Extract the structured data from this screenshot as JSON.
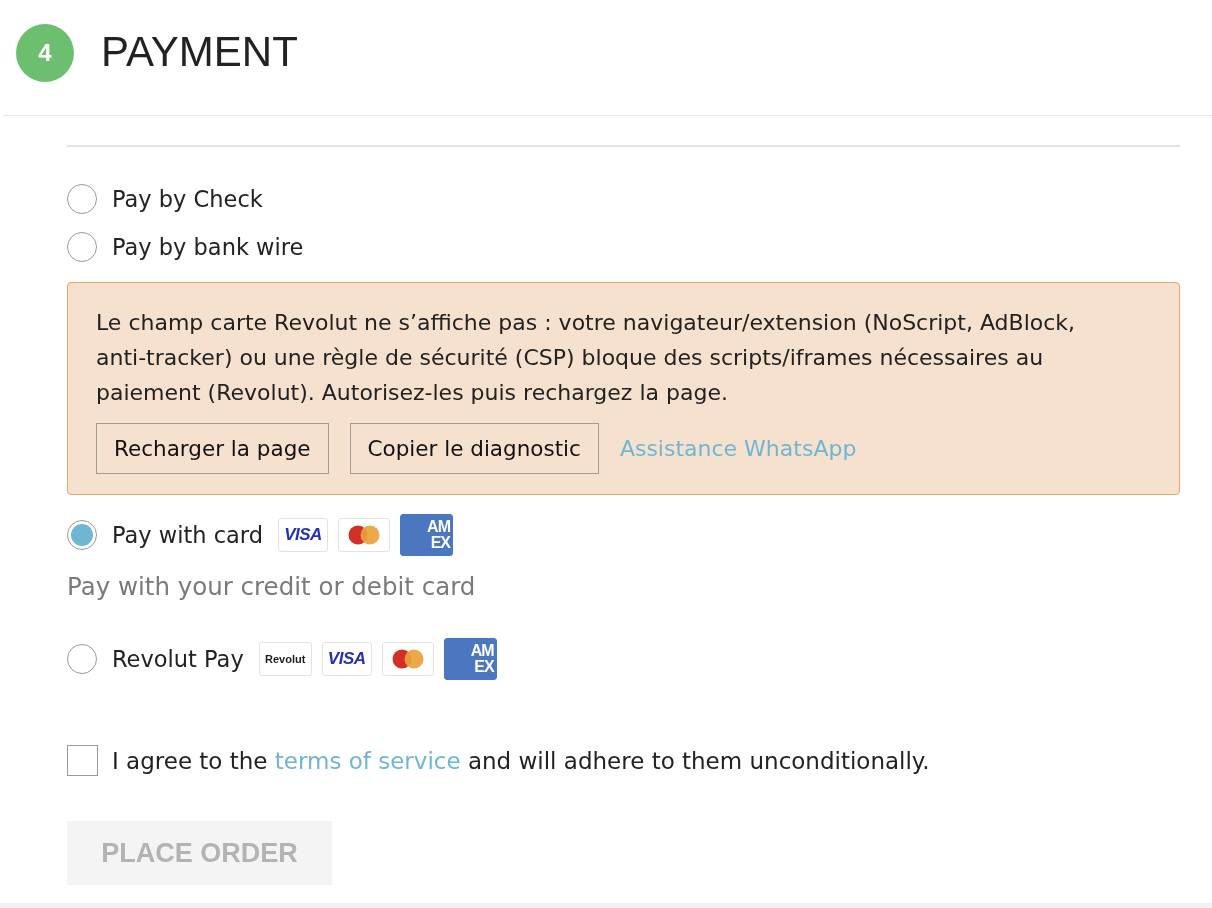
{
  "step": {
    "number": "4",
    "title": "PAYMENT"
  },
  "payment_options": [
    {
      "label": "Pay by Check",
      "selected": false
    },
    {
      "label": "Pay by bank wire",
      "selected": false
    },
    {
      "notice": {
        "message": "Le champ carte Revolut ne s’affiche pas : votre navigateur/extension (NoScript, AdBlock, anti-tracker) ou une règle de sécurité (CSP) bloque des scripts/iframes nécessaires au paiement (Revolut). Autorisez-les puis rechargez la page.",
        "buttons": [
          "Recharger la page",
          "Copier le diagnostic"
        ],
        "link": "Assistance WhatsApp"
      },
      "label": "Pay with card",
      "selected": true,
      "logos": [
        {
          "kind": "visa",
          "text": "VISA"
        },
        {
          "kind": "mastercard"
        },
        {
          "kind": "amex",
          "lines": [
            "AM",
            "EX"
          ]
        }
      ],
      "description": "Pay with your credit or debit card"
    },
    {
      "label": "Revolut Pay",
      "selected": false,
      "logos": [
        {
          "kind": "revolut",
          "text": "Revolut"
        },
        {
          "kind": "visa",
          "text": "VISA"
        },
        {
          "kind": "mastercard"
        },
        {
          "kind": "amex",
          "lines": [
            "AM",
            "EX"
          ]
        }
      ]
    }
  ],
  "terms": {
    "checked": false,
    "text_before": "I agree to the",
    "link": "terms of service",
    "text_after": "and will adhere to them unconditionally."
  },
  "place_order": {
    "label": "PLACE ORDER",
    "disabled": true
  }
}
